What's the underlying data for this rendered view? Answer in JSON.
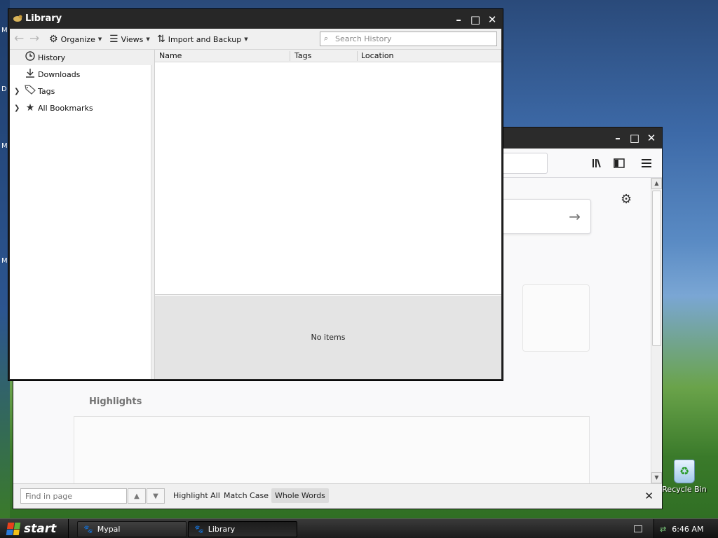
{
  "desktop": {
    "edge_letters": [
      "M",
      "D",
      "M",
      "M"
    ],
    "recycle_bin_label": "Recycle Bin"
  },
  "browser": {
    "window_controls": {
      "minimize": "–",
      "maximize": "□",
      "close": "✕"
    },
    "toolbar_icons": [
      "library-icon",
      "sidebar-icon",
      "menu-icon"
    ],
    "highlights_label": "Highlights",
    "findbar": {
      "placeholder": "Find in page",
      "highlight_all": "Highlight All",
      "match_case": "Match Case",
      "whole_words": "Whole Words",
      "whole_words_active": true
    }
  },
  "library": {
    "title": "Library",
    "window_controls": {
      "minimize": "–",
      "maximize": "□",
      "close": "✕"
    },
    "toolbar": {
      "organize": "Organize",
      "views": "Views",
      "import_backup": "Import and Backup",
      "search_placeholder": "Search History"
    },
    "sidebar": [
      {
        "label": "History",
        "icon": "clock-icon",
        "selected": true,
        "expandable": false
      },
      {
        "label": "Downloads",
        "icon": "download-icon",
        "selected": false,
        "expandable": false
      },
      {
        "label": "Tags",
        "icon": "tag-icon",
        "selected": false,
        "expandable": true
      },
      {
        "label": "All Bookmarks",
        "icon": "star-icon",
        "selected": false,
        "expandable": true
      }
    ],
    "columns": [
      "Name",
      "Tags",
      "Location"
    ],
    "details_text": "No items"
  },
  "taskbar": {
    "start_label": "start",
    "tasks": [
      {
        "label": "Mypal",
        "active": false
      },
      {
        "label": "Library",
        "active": true
      }
    ],
    "clock": "6:46 AM"
  }
}
